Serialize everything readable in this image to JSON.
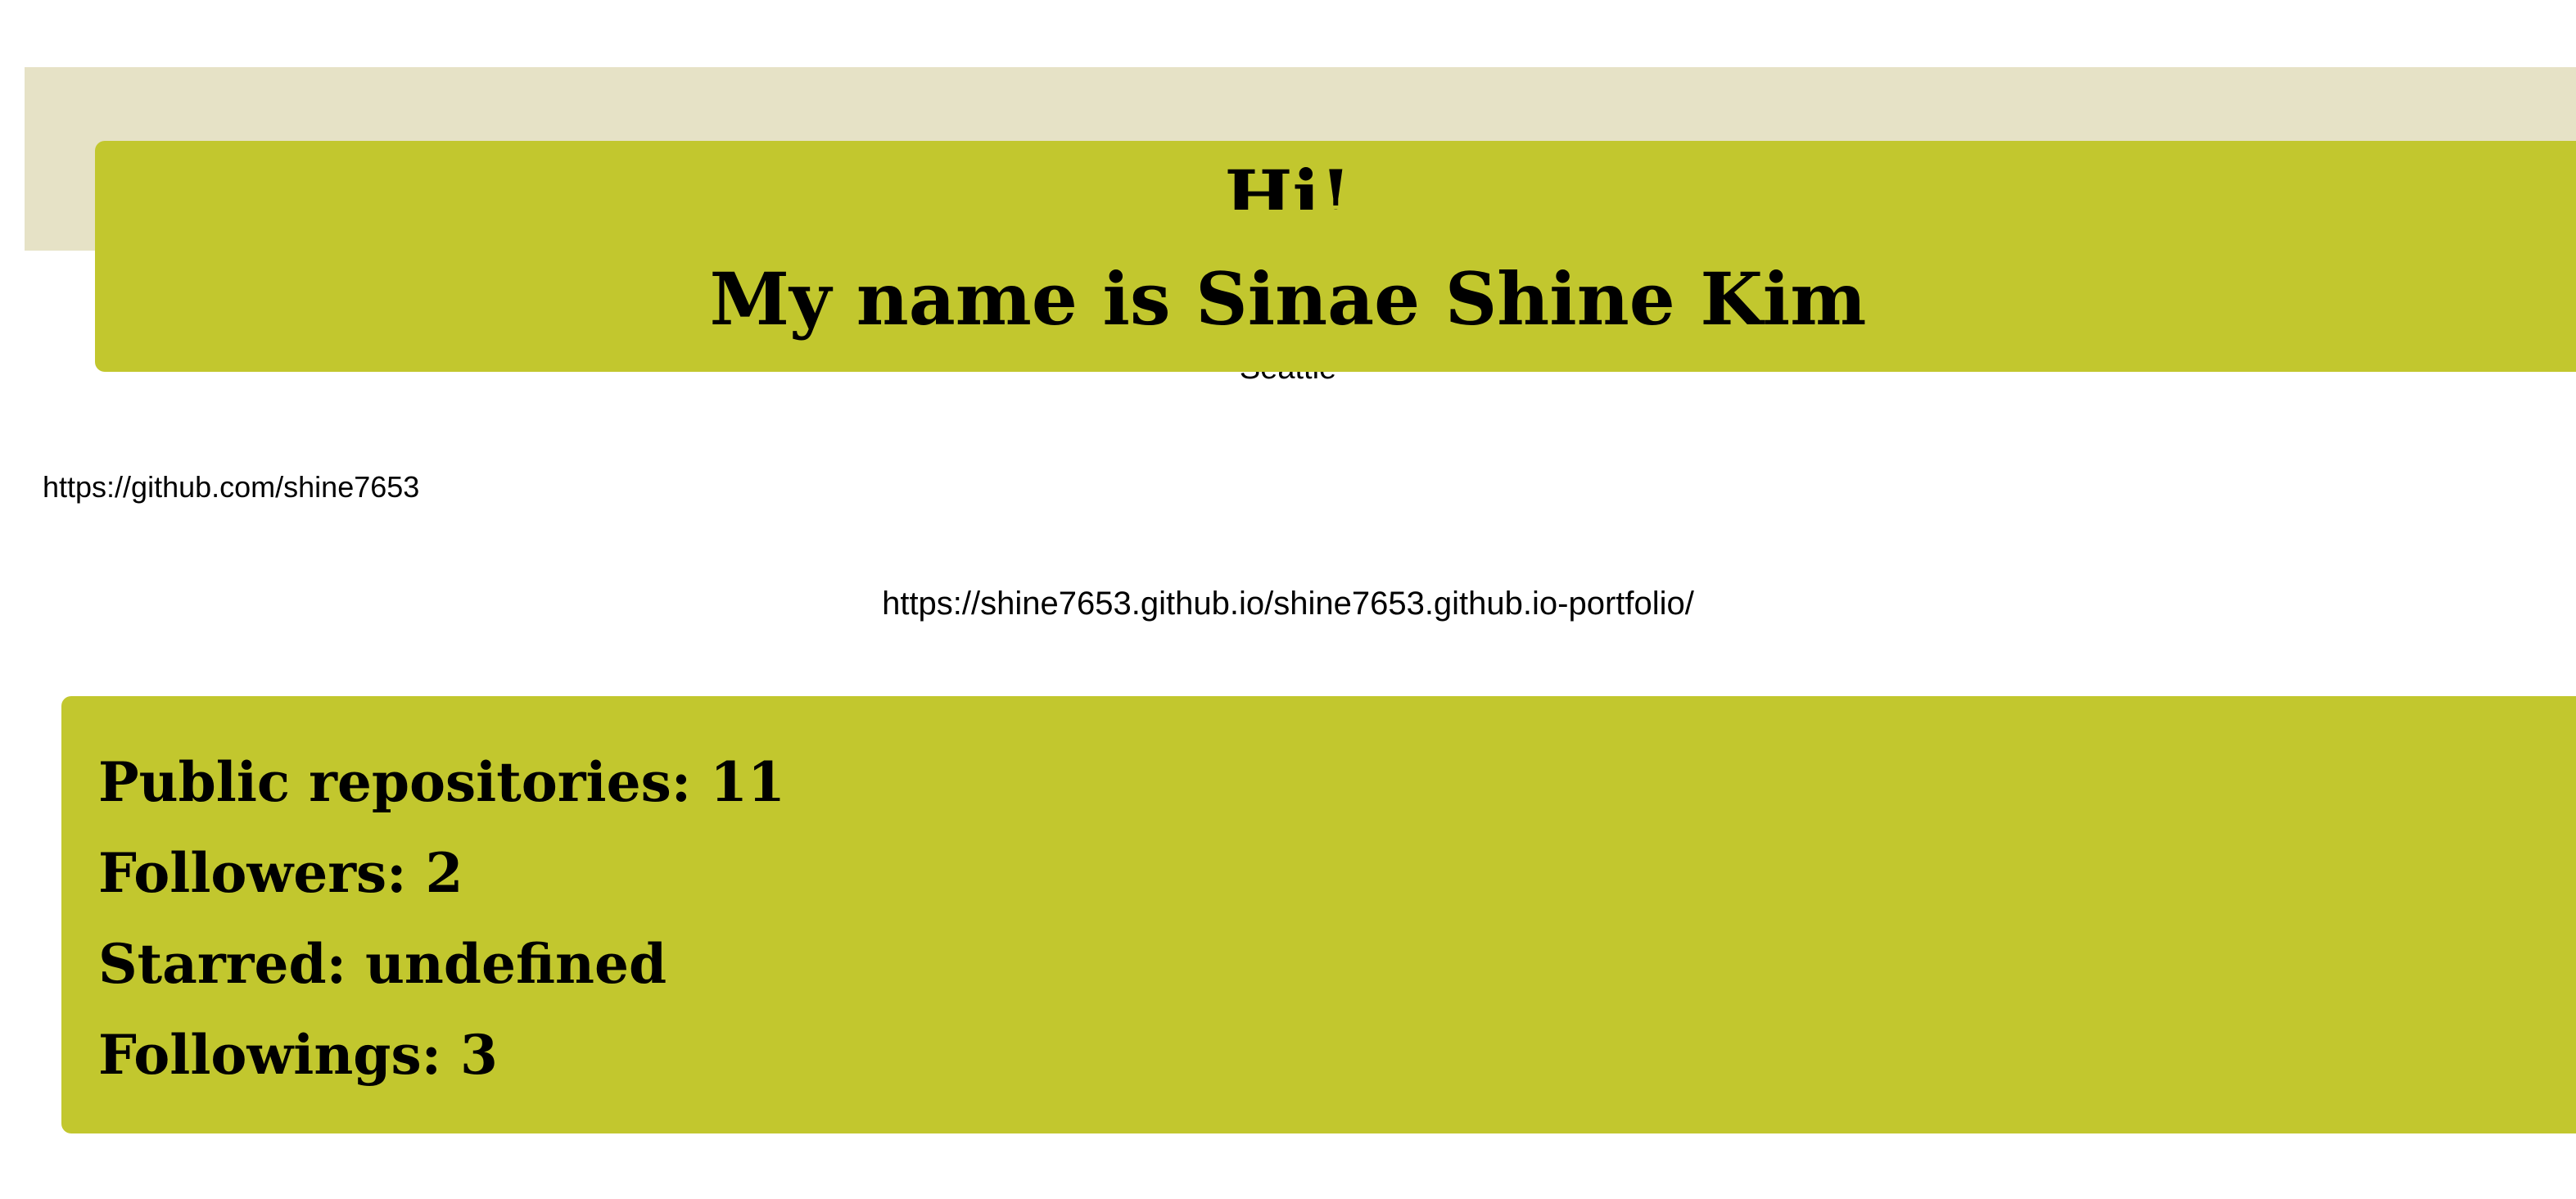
{
  "header": {
    "greeting": "Hi!",
    "name": "My name is Sinae Shine Kim",
    "location": "Seattle"
  },
  "links": {
    "github": "https://github.com/shine7653",
    "portfolio": "https://shine7653.github.io/shine7653.github.io-portfolio/"
  },
  "stats": {
    "repos": "Public repositories: 11",
    "followers": "Followers: 2",
    "starred": "Starred: undefined",
    "followings": "Followings: 3"
  },
  "colors": {
    "accent": "#c2c72e",
    "header_background": "#e6e2c6",
    "page_background": "#ffffff"
  }
}
